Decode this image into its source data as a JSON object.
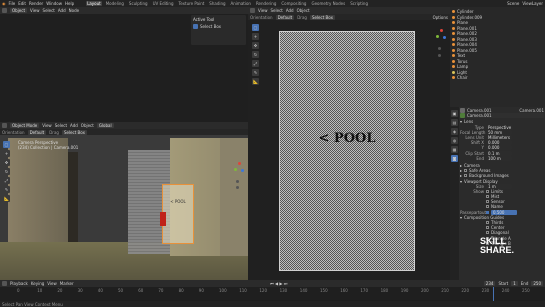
{
  "menu": {
    "items": [
      "File",
      "Edit",
      "Render",
      "Window",
      "Help"
    ],
    "workspaces": [
      "Layout",
      "Modeling",
      "Sculpting",
      "UV Editing",
      "Texture Paint",
      "Shading",
      "Animation",
      "Rendering",
      "Compositing",
      "Geometry Nodes",
      "Scripting"
    ],
    "active_workspace": "Layout",
    "scene_label": "Scene",
    "view_layer_label": "ViewLayer"
  },
  "top_left_editor": {
    "mode": "Object",
    "menus": [
      "View",
      "Select",
      "Add",
      "Node"
    ]
  },
  "active_tool": {
    "title": "Active Tool",
    "item": "Select Box"
  },
  "viewport_3d": {
    "mode": "Object Mode",
    "menus": [
      "View",
      "Select",
      "Add",
      "Object"
    ],
    "orientation": "Global",
    "transform_label": "Orientation",
    "transform_value": "Default",
    "drag_label": "Drag",
    "drag_value": "Select Box",
    "camera_info": "Camera Perspective",
    "collection_info": "(234) Collection | Camera.001",
    "sign_text": "< POOL"
  },
  "image_viewport": {
    "menus": [
      "View",
      "Select",
      "Add",
      "Object"
    ],
    "orientation_label": "Orientation",
    "orientation_value": "Default",
    "drag_label": "Drag",
    "drag_value": "Select Box",
    "options_label": "Options",
    "sign_text": "< POOL"
  },
  "outliner": {
    "items": [
      "Cylinder",
      "Cylinder.009",
      "Plane",
      "Plane.001",
      "Plane.002",
      "Plane.003",
      "Plane.004",
      "Plane.005",
      "Text",
      "Torus",
      "Lamp",
      "Light",
      "Chair"
    ]
  },
  "properties": {
    "object_name": "Camera.001",
    "data_name": "Camera.001",
    "lens_header": "Lens",
    "rows": [
      {
        "label": "Type",
        "value": "Perspective"
      },
      {
        "label": "Focal Length",
        "value": "50 mm"
      },
      {
        "label": "Lens Unit",
        "value": "Millimeters"
      },
      {
        "label": "Shift X",
        "value": "0.000"
      },
      {
        "label": "Y",
        "value": "0.000"
      },
      {
        "label": "Clip Start",
        "value": "0.1 m"
      },
      {
        "label": "End",
        "value": "100 m"
      }
    ],
    "camera_section": "Camera",
    "safe_areas": "Safe Areas",
    "background_images": "Background Images",
    "viewport_display": "Viewport Display",
    "size_label": "Size",
    "size_value": "1 m",
    "show_label": "Show",
    "show_items": [
      "Limits",
      "Mist",
      "Sensor",
      "Name"
    ],
    "passepartout_label": "Passepartout",
    "passepartout_value": "0.500",
    "composition_guides": "Composition Guides",
    "composition_items": [
      "Thirds",
      "Center",
      "Diagonal"
    ],
    "triangle_items": [
      "Triangle A",
      "Triangle B"
    ]
  },
  "timeline": {
    "menus": [
      "Playback",
      "Keying",
      "View",
      "Marker"
    ],
    "start_label": "Start",
    "start_value": "1",
    "end_label": "End",
    "end_value": "250",
    "current_frame": "234",
    "ticks": [
      "0",
      "10",
      "20",
      "30",
      "40",
      "50",
      "60",
      "70",
      "80",
      "90",
      "100",
      "110",
      "120",
      "130",
      "140",
      "150",
      "160",
      "170",
      "180",
      "190",
      "200",
      "210",
      "220",
      "230",
      "240",
      "250"
    ]
  },
  "status_bar": {
    "text": "Select  Pan View  Context Menu"
  },
  "watermark": {
    "line1": "SKILL",
    "line2": "SHARE."
  },
  "colors": {
    "accent": "#4772b3",
    "orange": "#e8913a",
    "red_shape": "#c0221a"
  }
}
